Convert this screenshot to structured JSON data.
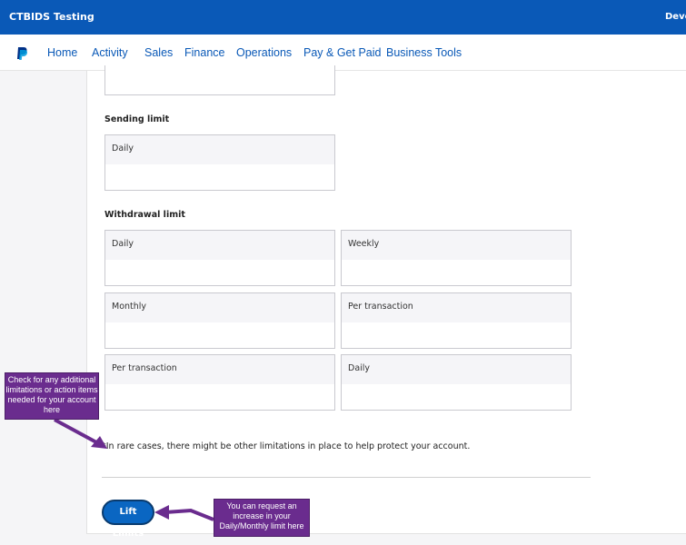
{
  "header": {
    "brand": "CTBIDS Testing",
    "right_text": "Devel"
  },
  "nav": {
    "logo": "paypal-logo-icon",
    "items": [
      "Home",
      "Activity",
      "Sales",
      "Finance",
      "Operations",
      "Pay & Get Paid",
      "Business Tools"
    ]
  },
  "sending": {
    "title": "Sending limit",
    "daily": "Daily"
  },
  "withdrawal": {
    "title": "Withdrawal limit",
    "boxes": [
      "Daily",
      "Weekly",
      "Monthly",
      "Per transaction",
      "Per transaction",
      "Daily"
    ]
  },
  "note": "*In rare cases, there might be other limitations in place to help protect your account.",
  "lift_button": "Lift Limits",
  "callouts": {
    "left": "Check for any additional limitations or action items needed for your account here",
    "right": "You can request an increase in your Daily/Monthly limit here"
  },
  "colors": {
    "topbar": "#0a59b7",
    "link": "#0a59b7",
    "callout": "#6a2c8e",
    "button": "#0a66c2"
  }
}
